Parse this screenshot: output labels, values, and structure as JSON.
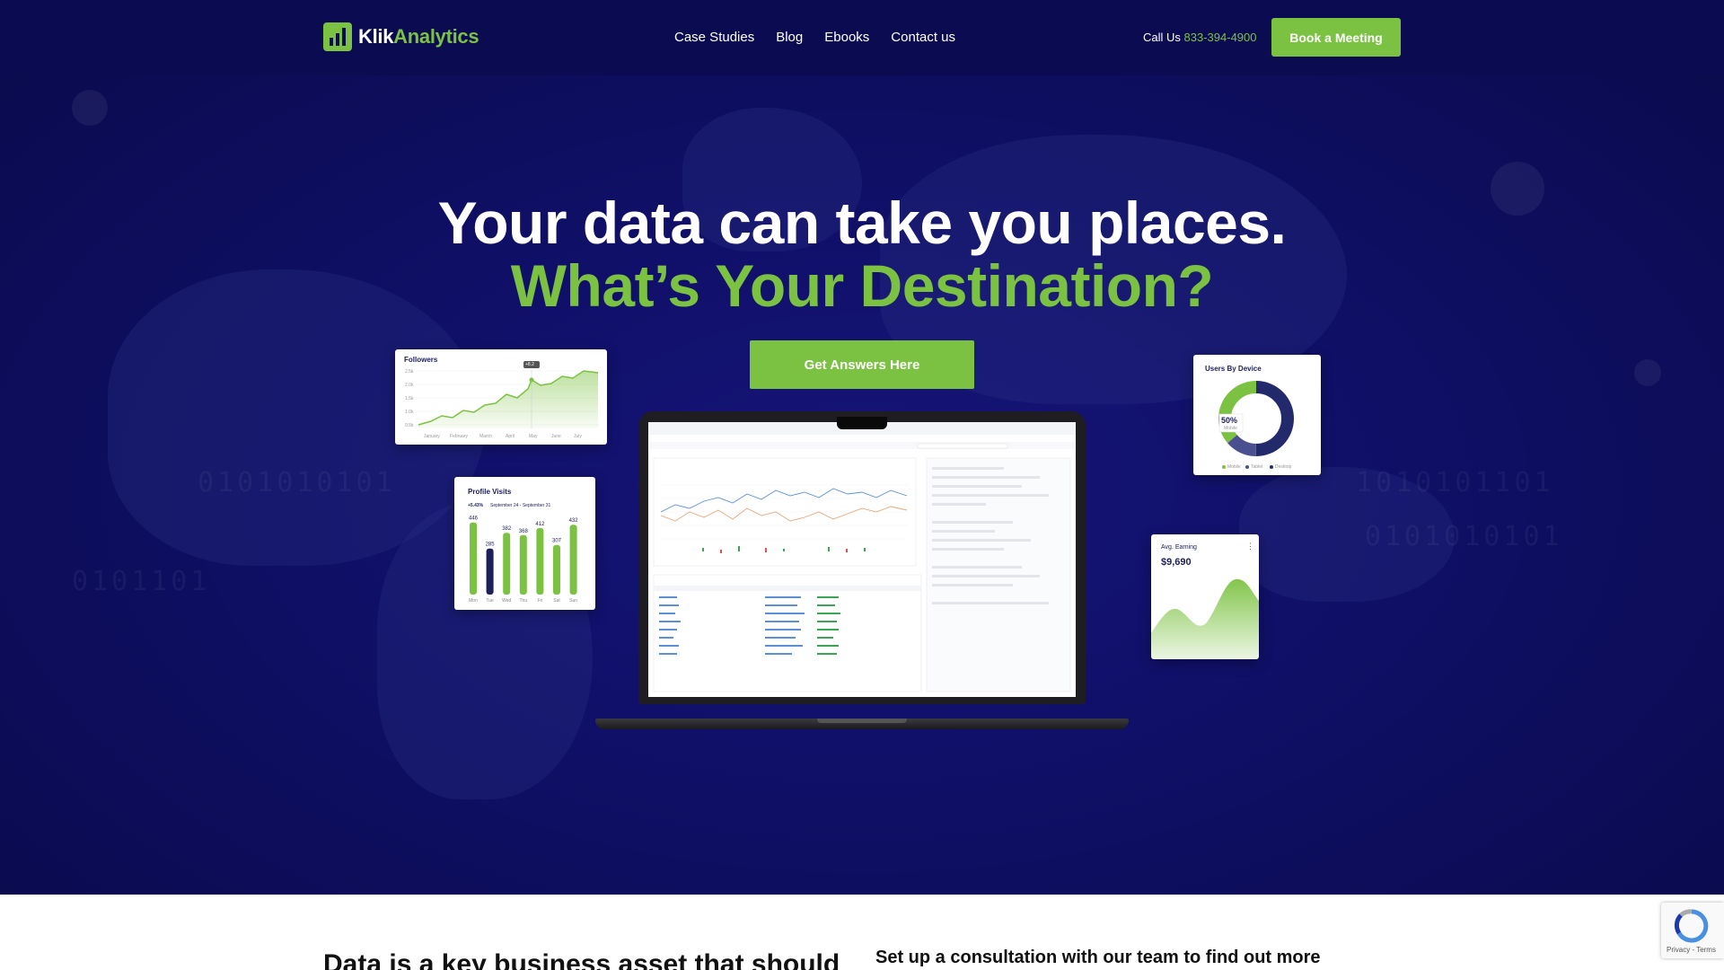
{
  "brand": {
    "name_part1": "Klik",
    "name_part2": "Analytics",
    "color_primary": "#7cc242",
    "color_dark": "#0b0b52"
  },
  "nav": {
    "links": [
      "Case Studies",
      "Blog",
      "Ebooks",
      "Contact us"
    ],
    "call_prefix": "Call Us",
    "call_number": "833-394-4900",
    "cta": "Book a Meeting"
  },
  "hero": {
    "headline_1": "Your data can take you places.",
    "headline_2": "What’s Your Destination?",
    "cta": "Get Answers Here"
  },
  "widgets": {
    "followers": {
      "title": "Followers",
      "y_ticks": [
        "2.5k",
        "2.0k",
        "1.5k",
        "1.0k",
        "0.5k",
        "0.0k"
      ],
      "x_ticks": [
        "January",
        "February",
        "March",
        "April",
        "May",
        "June",
        "July"
      ],
      "tooltip": "+8.2"
    },
    "profile_visits": {
      "title": "Profile Visits",
      "change": "+5.43%",
      "range": "September 24 - September 31",
      "days": [
        "Mon",
        "Tue",
        "Wed",
        "Thu",
        "Fri",
        "Sat",
        "Sun"
      ],
      "values": [
        446,
        285,
        382,
        368,
        412,
        307,
        432
      ]
    },
    "users_by_device": {
      "title": "Users By Device",
      "center_pct": "50%",
      "center_label": "Mobile",
      "legend": [
        "Mobile",
        "Tablet",
        "Desktop"
      ]
    },
    "avg_earning": {
      "title": "Avg. Earning",
      "value": "$9,690"
    }
  },
  "lower": {
    "left_heading": "Data is a key business asset that should",
    "right_heading": "Set up a consultation with our team to find out more"
  },
  "recaptcha": {
    "terms": "Privacy - Terms"
  }
}
